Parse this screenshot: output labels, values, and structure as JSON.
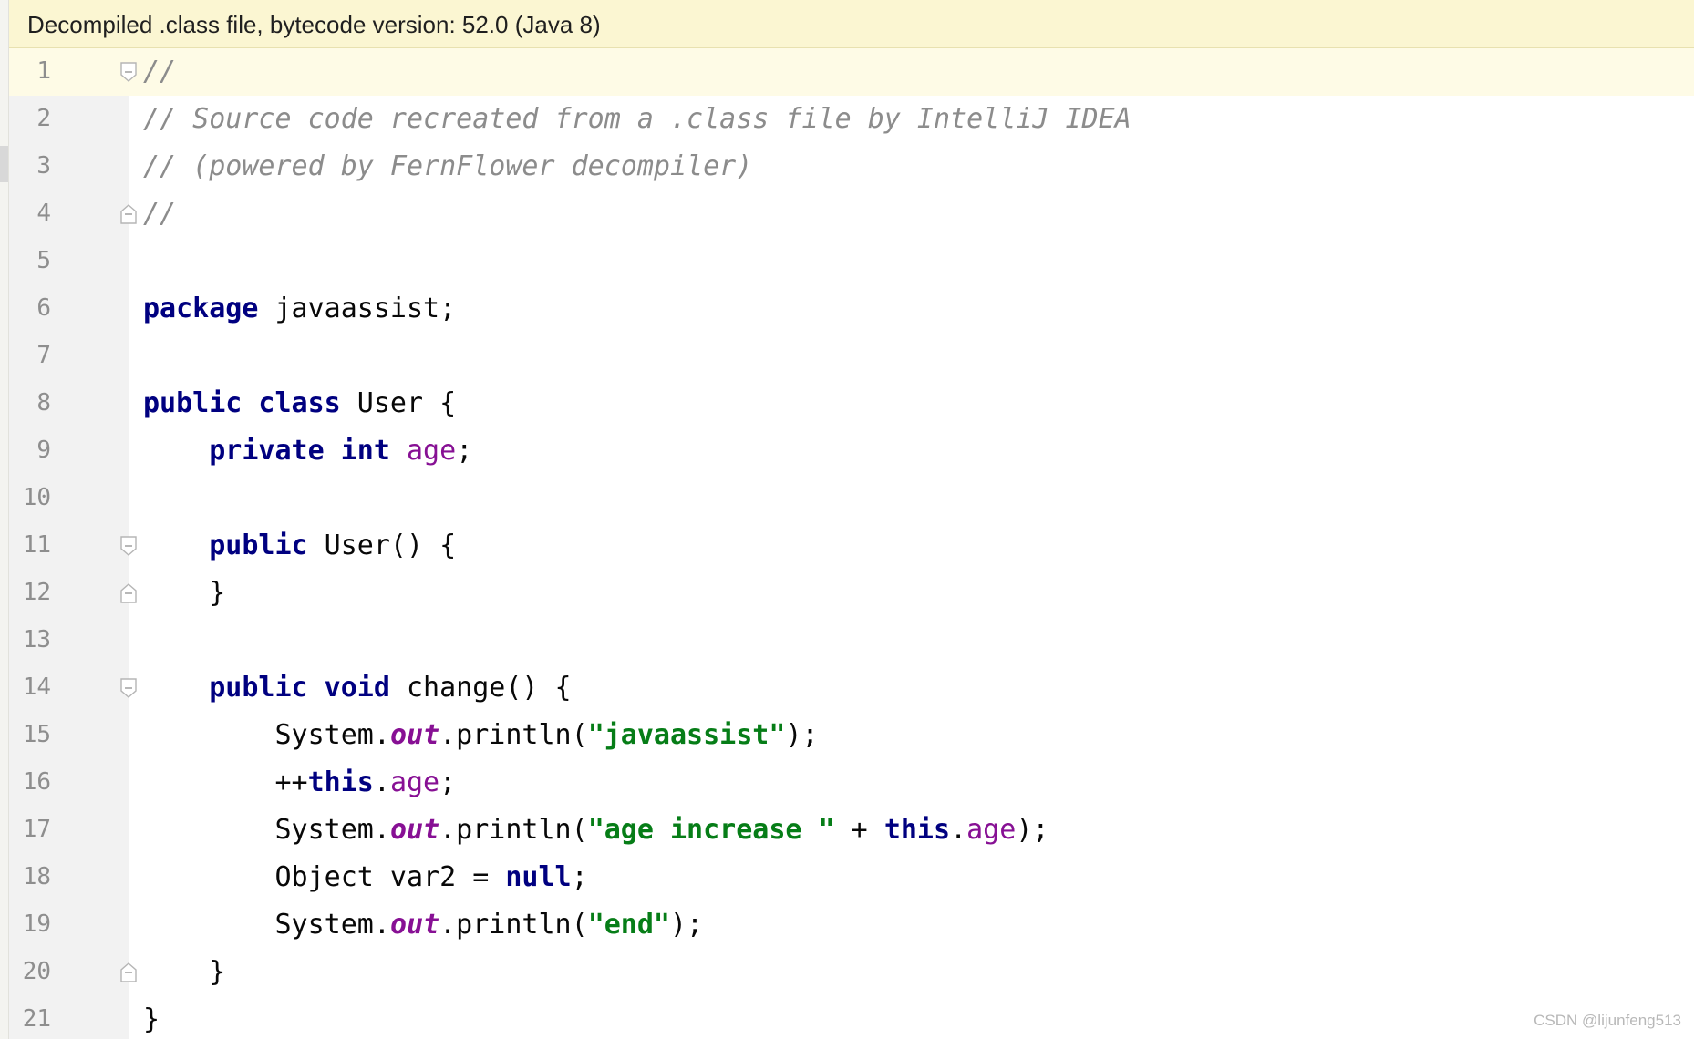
{
  "banner": {
    "text": "Decompiled .class file, bytecode version: 52.0 (Java 8)"
  },
  "editor": {
    "current_line": 1,
    "lines": [
      {
        "number": "1",
        "fold": "start",
        "tokens": [
          {
            "t": "c",
            "v": "//"
          }
        ]
      },
      {
        "number": "2",
        "fold": "",
        "tokens": [
          {
            "t": "c",
            "v": "// Source code recreated from a .class file by IntelliJ IDEA"
          }
        ]
      },
      {
        "number": "3",
        "fold": "",
        "tokens": [
          {
            "t": "c",
            "v": "// (powered by FernFlower decompiler)"
          }
        ]
      },
      {
        "number": "4",
        "fold": "end",
        "tokens": [
          {
            "t": "c",
            "v": "//"
          }
        ]
      },
      {
        "number": "5",
        "fold": "",
        "tokens": []
      },
      {
        "number": "6",
        "fold": "",
        "tokens": [
          {
            "t": "k",
            "v": "package"
          },
          {
            "t": "p",
            "v": " javaassist;"
          }
        ]
      },
      {
        "number": "7",
        "fold": "",
        "tokens": []
      },
      {
        "number": "8",
        "fold": "",
        "tokens": [
          {
            "t": "k",
            "v": "public class"
          },
          {
            "t": "p",
            "v": " User {"
          }
        ]
      },
      {
        "number": "9",
        "fold": "",
        "tokens": [
          {
            "t": "p",
            "v": "    "
          },
          {
            "t": "k",
            "v": "private int"
          },
          {
            "t": "p",
            "v": " "
          },
          {
            "t": "f",
            "v": "age"
          },
          {
            "t": "p",
            "v": ";"
          }
        ]
      },
      {
        "number": "10",
        "fold": "",
        "tokens": []
      },
      {
        "number": "11",
        "fold": "start",
        "tokens": [
          {
            "t": "p",
            "v": "    "
          },
          {
            "t": "k",
            "v": "public"
          },
          {
            "t": "p",
            "v": " User() {"
          }
        ]
      },
      {
        "number": "12",
        "fold": "end",
        "tokens": [
          {
            "t": "p",
            "v": "    }"
          }
        ]
      },
      {
        "number": "13",
        "fold": "",
        "tokens": []
      },
      {
        "number": "14",
        "fold": "start",
        "tokens": [
          {
            "t": "p",
            "v": "    "
          },
          {
            "t": "k",
            "v": "public void"
          },
          {
            "t": "p",
            "v": " change() {"
          }
        ]
      },
      {
        "number": "15",
        "fold": "",
        "tokens": [
          {
            "t": "p",
            "v": "        System."
          },
          {
            "t": "fs",
            "v": "out"
          },
          {
            "t": "p",
            "v": ".println("
          },
          {
            "t": "s",
            "v": "\"javaassist\""
          },
          {
            "t": "p",
            "v": ");"
          }
        ]
      },
      {
        "number": "16",
        "fold": "",
        "tokens": [
          {
            "t": "p",
            "v": "        ++"
          },
          {
            "t": "k",
            "v": "this"
          },
          {
            "t": "p",
            "v": "."
          },
          {
            "t": "f",
            "v": "age"
          },
          {
            "t": "p",
            "v": ";"
          }
        ]
      },
      {
        "number": "17",
        "fold": "",
        "tokens": [
          {
            "t": "p",
            "v": "        System."
          },
          {
            "t": "fs",
            "v": "out"
          },
          {
            "t": "p",
            "v": ".println("
          },
          {
            "t": "s",
            "v": "\"age increase \""
          },
          {
            "t": "p",
            "v": " + "
          },
          {
            "t": "k",
            "v": "this"
          },
          {
            "t": "p",
            "v": "."
          },
          {
            "t": "f",
            "v": "age"
          },
          {
            "t": "p",
            "v": ");"
          }
        ]
      },
      {
        "number": "18",
        "fold": "",
        "tokens": [
          {
            "t": "p",
            "v": "        Object var2 = "
          },
          {
            "t": "k",
            "v": "null"
          },
          {
            "t": "p",
            "v": ";"
          }
        ]
      },
      {
        "number": "19",
        "fold": "",
        "tokens": [
          {
            "t": "p",
            "v": "        System."
          },
          {
            "t": "fs",
            "v": "out"
          },
          {
            "t": "p",
            "v": ".println("
          },
          {
            "t": "s",
            "v": "\"end\""
          },
          {
            "t": "p",
            "v": ");"
          }
        ]
      },
      {
        "number": "20",
        "fold": "end",
        "tokens": [
          {
            "t": "p",
            "v": "    }"
          }
        ]
      },
      {
        "number": "21",
        "fold": "",
        "tokens": [
          {
            "t": "p",
            "v": "}"
          }
        ]
      }
    ]
  },
  "watermark": "CSDN @lijunfeng513",
  "colors": {
    "banner_bg": "#fbf6d2",
    "keyword": "#000080",
    "field": "#871094",
    "string": "#067d17",
    "comment": "#8c8c8c",
    "line_number": "#8e8e8e"
  }
}
